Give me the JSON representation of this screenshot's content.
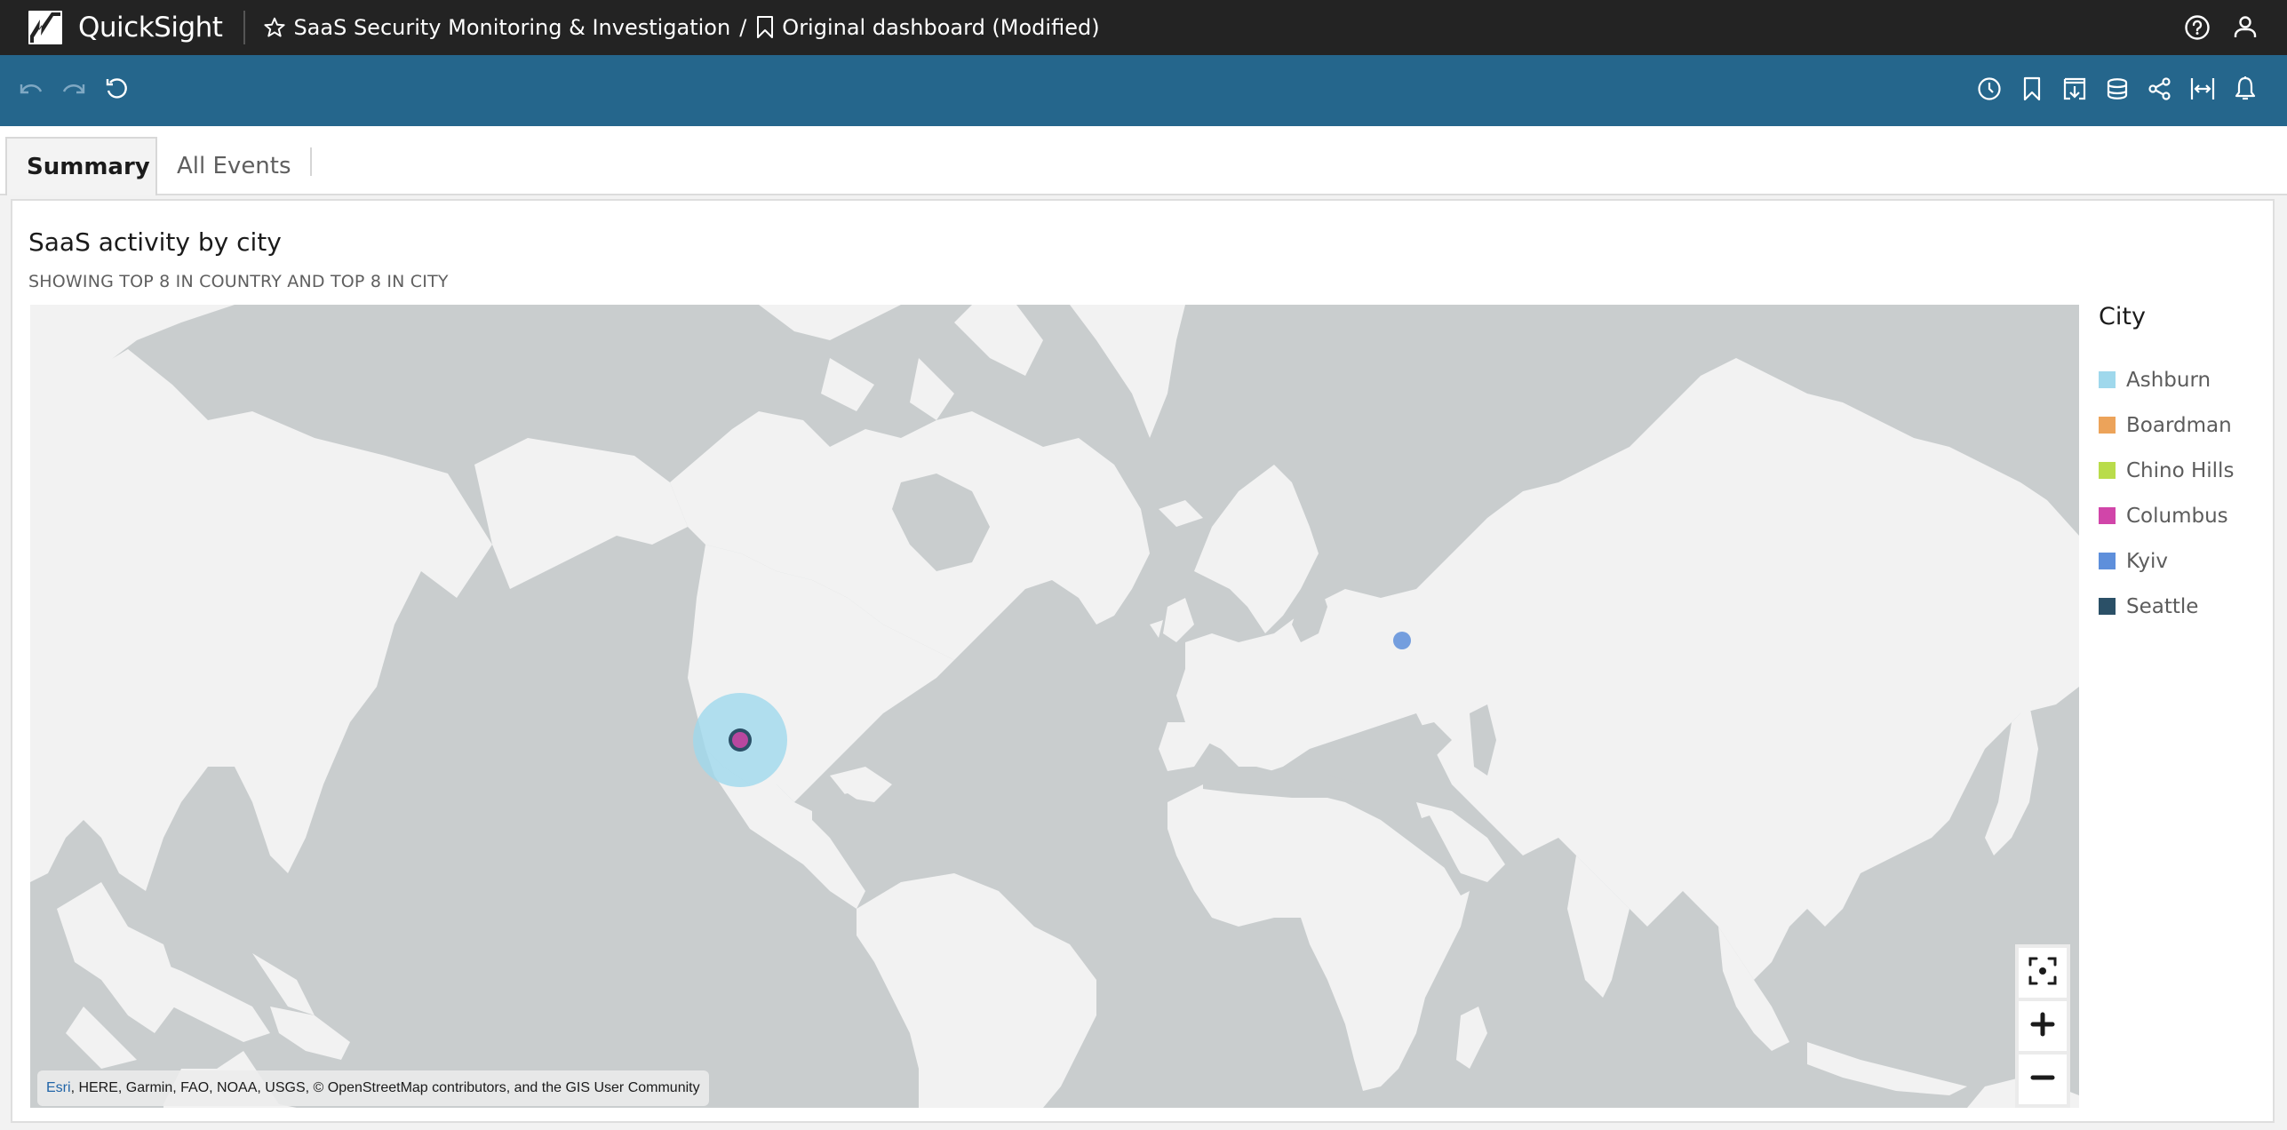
{
  "app": {
    "name": "QuickSight",
    "breadcrumb": {
      "analysis": "SaaS Security Monitoring & Investigation",
      "divider": "/",
      "dashboard": "Original dashboard (Modified)"
    },
    "icons": {
      "help": "help-circle-icon",
      "user": "user-icon"
    }
  },
  "toolbar": {
    "left": [
      {
        "name": "undo",
        "icon": "undo-icon",
        "enabled": false
      },
      {
        "name": "redo",
        "icon": "redo-icon",
        "enabled": false
      },
      {
        "name": "reset",
        "icon": "reset-icon",
        "enabled": true
      }
    ],
    "right": [
      {
        "name": "schedule",
        "icon": "clock-icon"
      },
      {
        "name": "bookmark",
        "icon": "bookmark-icon"
      },
      {
        "name": "export",
        "icon": "download-icon"
      },
      {
        "name": "dataset",
        "icon": "database-icon"
      },
      {
        "name": "share",
        "icon": "share-icon"
      },
      {
        "name": "fit-width",
        "icon": "fit-width-icon"
      },
      {
        "name": "alerts",
        "icon": "bell-icon"
      }
    ]
  },
  "tabs": [
    {
      "label": "Summary",
      "active": true
    },
    {
      "label": "All Events",
      "active": false
    }
  ],
  "visual": {
    "title": "SaaS activity by city",
    "subtitle": "SHOWING TOP 8 IN COUNTRY AND TOP 8 IN CITY",
    "type": "point map",
    "legend": {
      "title": "City",
      "items": [
        {
          "label": "Ashburn",
          "color": "#9fd8ec"
        },
        {
          "label": "Boardman",
          "color": "#eca35a"
        },
        {
          "label": "Chino Hills",
          "color": "#b9dc4b"
        },
        {
          "label": "Columbus",
          "color": "#d145a9"
        },
        {
          "label": "Kyiv",
          "color": "#5e8fdb"
        },
        {
          "label": "Seattle",
          "color": "#2b5067"
        }
      ]
    },
    "points": [
      {
        "city": "Ashburn",
        "size": "large",
        "color": "#9fd8ec",
        "opacity": 0.75
      },
      {
        "city": "Seattle",
        "size": "small",
        "color": "#2b5067"
      },
      {
        "city": "Columbus",
        "size": "small",
        "color": "#d145a9"
      },
      {
        "city": "Kyiv",
        "size": "small",
        "color": "#5e8fdb"
      }
    ],
    "map_colors": {
      "water": "#c9cdce",
      "land": "#f2f2f2"
    },
    "attribution": {
      "link": "Esri",
      "text": ", HERE, Garmin, FAO, NOAA, USGS, © OpenStreetMap contributors, and the GIS User Community"
    },
    "map_controls": [
      {
        "name": "recenter",
        "icon": "recenter-icon"
      },
      {
        "name": "zoom-in",
        "icon": "plus-icon"
      },
      {
        "name": "zoom-out",
        "icon": "minus-icon"
      }
    ]
  }
}
